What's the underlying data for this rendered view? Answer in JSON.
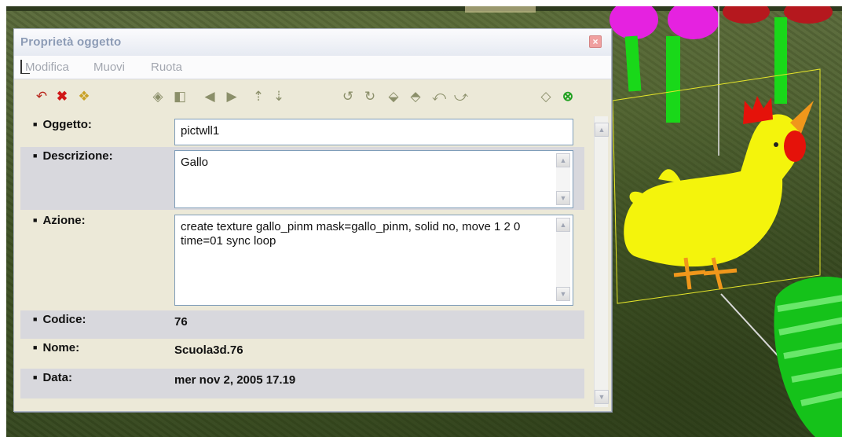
{
  "window": {
    "title": "Proprietà oggetto",
    "close_symbol": "×"
  },
  "menu": {
    "items": [
      "Modifica",
      "Muovi",
      "Ruota"
    ]
  },
  "toolbar": {
    "icons": [
      "undo-icon",
      "delete-icon",
      "duplicate-icon",
      "move-left-icon",
      "move-right-icon",
      "move-forward-icon",
      "move-backward-icon",
      "move-up-icon",
      "move-down-icon",
      "rotate-left-icon",
      "rotate-right-icon",
      "tilt-forward-icon",
      "tilt-backward-icon",
      "roll-left-icon",
      "roll-right-icon",
      "reset-icon",
      "select-icon"
    ]
  },
  "fields": {
    "oggetto": {
      "label": "Oggetto:",
      "value": "pictwll1"
    },
    "descrizione": {
      "label": "Descrizione:",
      "value": "Gallo"
    },
    "azione": {
      "label": "Azione:",
      "value": "create  texture gallo_pinm mask=gallo_pinm, solid no, move 1 2 0 time=01 sync loop"
    },
    "codice": {
      "label": "Codice:",
      "value": "76"
    },
    "nome": {
      "label": "Nome:",
      "value": "Scuola3d.76"
    },
    "data": {
      "label": "Data:",
      "value": "mer nov 2, 2005 17.19"
    }
  },
  "colors": {
    "selection_box": "#e6e62a",
    "title_text": "#8d9cb6",
    "shaded_row": "#d8d8dd"
  }
}
